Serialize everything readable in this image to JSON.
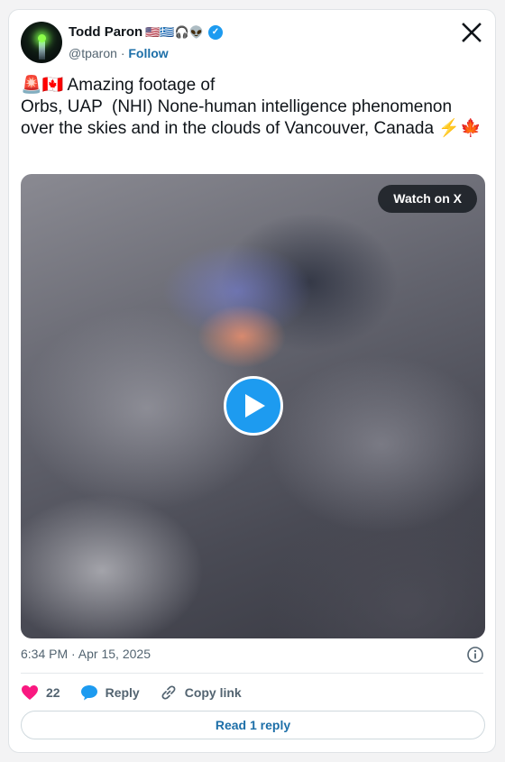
{
  "author": {
    "name": "Todd Paron",
    "name_emojis": "🇺🇸🇬🇷🎧👽",
    "handle": "@tparon",
    "separator": "·",
    "follow_label": "Follow"
  },
  "tweet": {
    "text": "🚨🇨🇦 Amazing footage of\nOrbs, UAP  (NHI) None-human intelligence phenomenon over the skies and in the clouds of Vancouver, Canada ⚡️🍁"
  },
  "media": {
    "watch_label": "Watch on X"
  },
  "meta": {
    "timestamp": "6:34 PM · Apr 15, 2025"
  },
  "actions": {
    "likes": "22",
    "reply_label": "Reply",
    "copy_label": "Copy link"
  },
  "footer": {
    "read_reply_label": "Read 1 reply"
  },
  "colors": {
    "accent": "#1d9bf0",
    "link": "#1d6fa8",
    "like": "#f91880"
  }
}
